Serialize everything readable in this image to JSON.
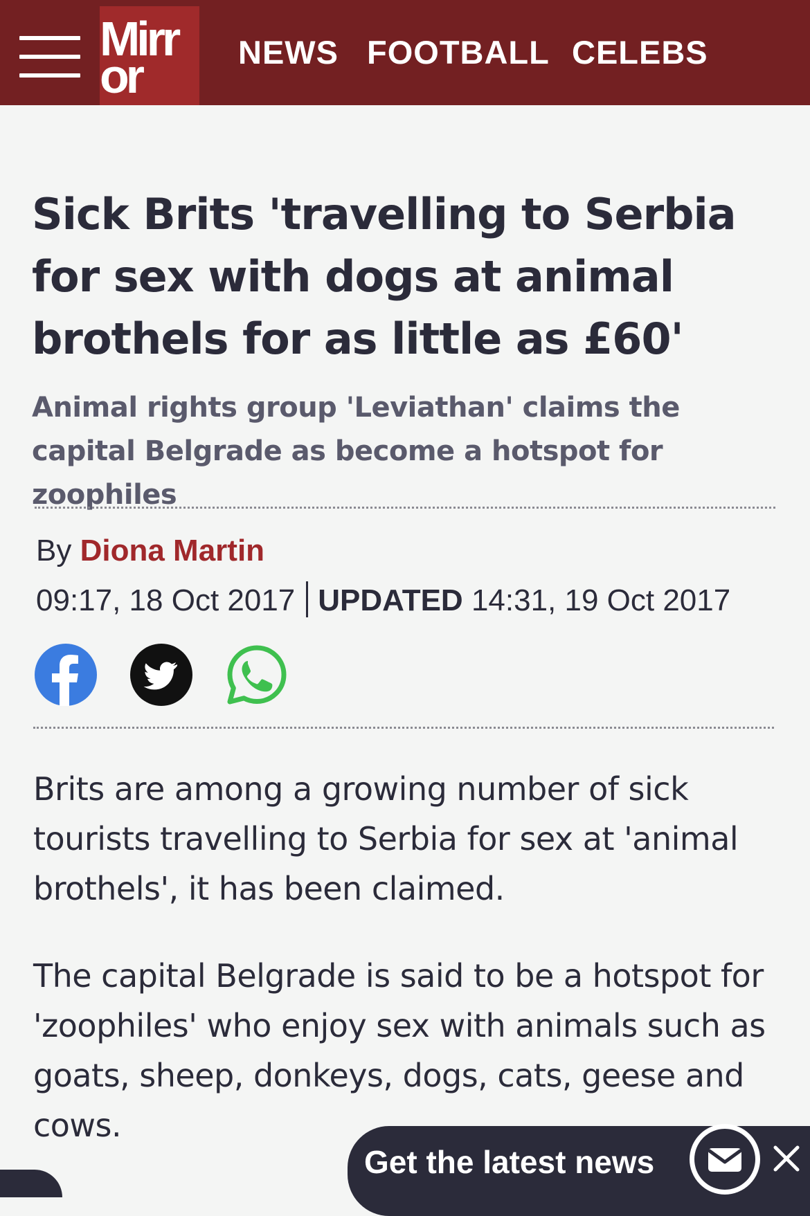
{
  "header": {
    "logo_line1": "Mirr",
    "logo_line2": "or",
    "nav": [
      "NEWS",
      "FOOTBALL",
      "CELEBS"
    ]
  },
  "article": {
    "headline": "Sick Brits 'travelling to Serbia for sex with dogs at animal brothels for as little as £60'",
    "standfirst": "Animal rights group 'Leviathan' claims the capital Belgrade as become a hotspot for zoophiles",
    "by_label": "By",
    "author": "Diona Martin",
    "published": "09:17, 18 Oct 2017",
    "updated_label": "UPDATED",
    "updated": "14:31, 19 Oct 2017",
    "paragraphs": [
      "Brits are among a growing number of sick tourists travelling to Serbia for sex at 'animal brothels', it has been claimed.",
      "The capital Belgrade is said to be a hotspot for 'zoophiles' who enjoy sex with animals such as goats, sheep, donkeys, dogs, cats, geese and cows."
    ]
  },
  "share": {
    "icons": [
      "facebook-icon",
      "twitter-icon",
      "whatsapp-icon"
    ]
  },
  "newsletter_cta": {
    "label": "Get the latest news",
    "icons": [
      "mail-icon",
      "close-icon"
    ]
  },
  "colors": {
    "header_bg": "#732022",
    "logo_bg": "#a02a2b",
    "author": "#a0282b",
    "text": "#2b2b3a",
    "standfirst": "#5a5a6c",
    "facebook": "#3b7ce0",
    "whatsapp": "#3fc04f"
  }
}
